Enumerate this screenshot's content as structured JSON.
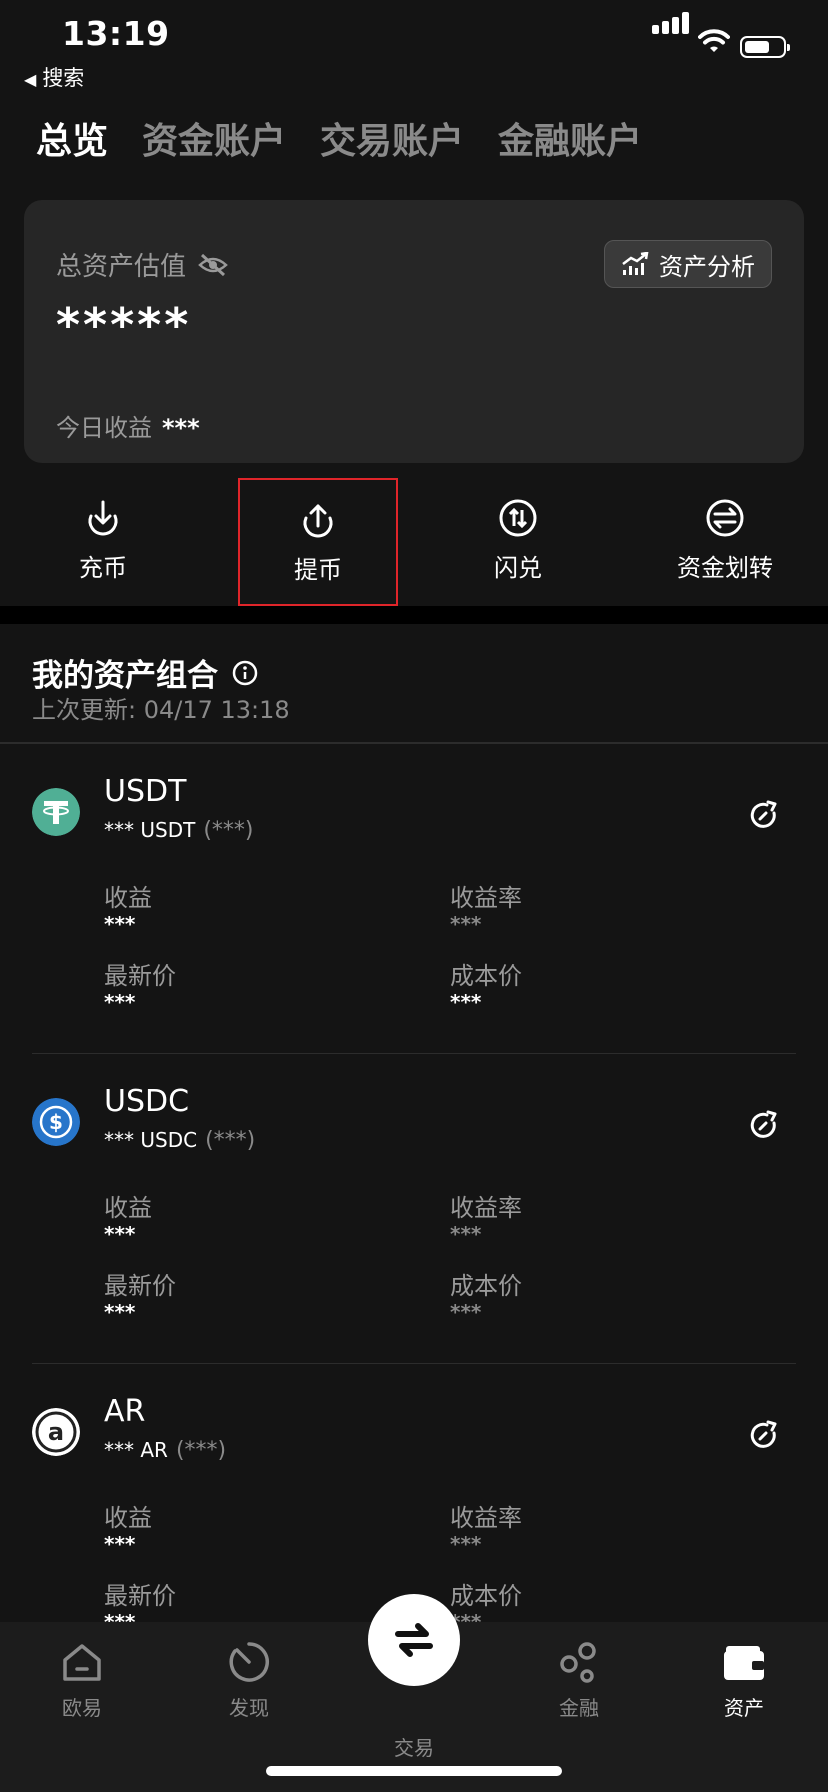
{
  "status_bar": {
    "time": "13:19",
    "back_label": "搜索"
  },
  "tabs": [
    {
      "label": "总览"
    },
    {
      "label": "资金账户"
    },
    {
      "label": "交易账户"
    },
    {
      "label": "金融账户"
    }
  ],
  "summary": {
    "label": "总资产估值",
    "value": "*****",
    "today_label": "今日收益",
    "today_value": "***",
    "analysis_button": "资产分析"
  },
  "actions": [
    {
      "label": "充币",
      "icon": "deposit-icon"
    },
    {
      "label": "提币",
      "icon": "withdraw-icon"
    },
    {
      "label": "闪兑",
      "icon": "swap-icon"
    },
    {
      "label": "资金划转",
      "icon": "transfer-icon"
    }
  ],
  "portfolio": {
    "title": "我的资产组合",
    "updated": "上次更新: 04/17 13:18"
  },
  "assets": [
    {
      "name": "USDT",
      "amount": "*** USDT",
      "amount_sub": "(***)",
      "color": "#50af95",
      "fields": {
        "profit_label": "收益",
        "profit": "***",
        "rate_label": "收益率",
        "rate": "***",
        "price_label": "最新价",
        "price": "***",
        "cost_label": "成本价",
        "cost": "***"
      }
    },
    {
      "name": "USDC",
      "amount": "*** USDC",
      "amount_sub": "(***)",
      "color": "#2775ca",
      "fields": {
        "profit_label": "收益",
        "profit": "***",
        "rate_label": "收益率",
        "rate": "***",
        "price_label": "最新价",
        "price": "***",
        "cost_label": "成本价",
        "cost": "***"
      }
    },
    {
      "name": "AR",
      "amount": "*** AR",
      "amount_sub": "(***)",
      "color": "#ffffff",
      "fields": {
        "profit_label": "收益",
        "profit": "***",
        "rate_label": "收益率",
        "rate": "***",
        "price_label": "最新价",
        "price": "***",
        "cost_label": "成本价",
        "cost": "***"
      }
    }
  ],
  "bottom_nav": [
    {
      "label": "欧易",
      "icon": "home-icon"
    },
    {
      "label": "发现",
      "icon": "discover-icon"
    },
    {
      "label": "交易",
      "icon": "trade-icon"
    },
    {
      "label": "金融",
      "icon": "finance-icon"
    },
    {
      "label": "资产",
      "icon": "wallet-icon"
    }
  ]
}
